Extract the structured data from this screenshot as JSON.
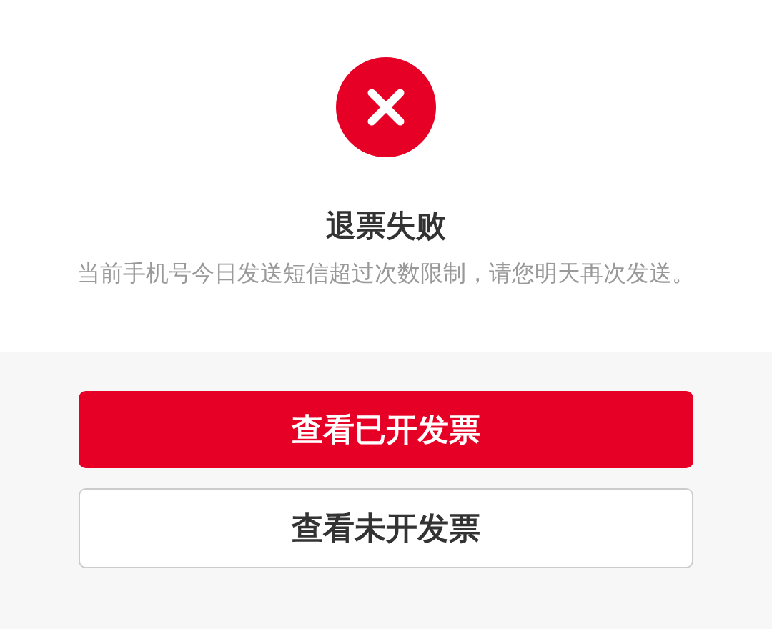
{
  "result": {
    "title": "退票失败",
    "message": "当前手机号今日发送短信超过次数限制，请您明天再次发送。"
  },
  "buttons": [
    {
      "label": "查看已开发票",
      "kind": "primary"
    },
    {
      "label": "查看未开发票",
      "kind": "secondary"
    }
  ]
}
